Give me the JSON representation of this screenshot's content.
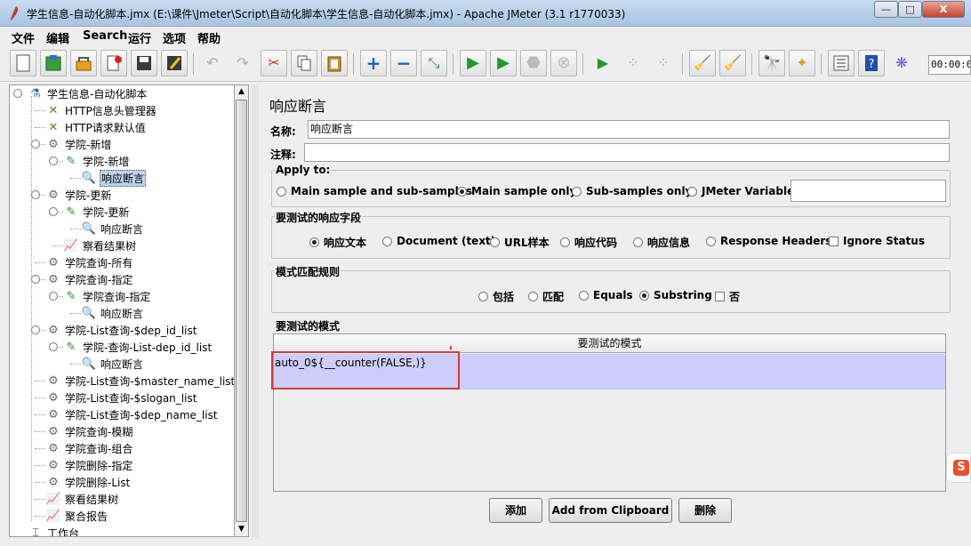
{
  "window": {
    "title": "学生信息-自动化脚本.jmx (E:\\课件\\Jmeter\\Script\\自动化脚本\\学生信息-自动化脚本.jmx) - Apache JMeter (3.1 r1770033)",
    "minimize": "—",
    "maximize": "□",
    "close": "X"
  },
  "menu": [
    "文件",
    "编辑",
    "Search",
    "运行",
    "选项",
    "帮助"
  ],
  "toolbar": {
    "icons": [
      "new-icon",
      "templates-icon",
      "open-icon",
      "close-icon",
      "save-icon",
      "save-as-icon",
      "undo-icon",
      "redo-icon",
      "cut-icon",
      "copy-icon",
      "paste-icon",
      "expand-icon",
      "collapse-icon",
      "toggle-icon",
      "start-icon",
      "start-no-timers-icon",
      "stop-icon",
      "shutdown-icon",
      "remote-start-icon",
      "remote-stop-icon",
      "remote-shutdown-icon",
      "clear-icon",
      "clear-all-icon",
      "search-icon",
      "reset-search-icon",
      "function-helper-icon",
      "help-icon",
      "log-viewer-icon"
    ],
    "timer": "00:00:0"
  },
  "tree": [
    {
      "label": "学生信息-自动化脚本",
      "icon": "test-plan-icon",
      "level": 0
    },
    {
      "label": "HTTP信息头管理器",
      "icon": "config-element-icon",
      "level": 1
    },
    {
      "label": "HTTP请求默认值",
      "icon": "config-element-icon",
      "level": 1
    },
    {
      "label": "学院-新增",
      "icon": "thread-group-icon",
      "level": 1
    },
    {
      "label": "学院-新增",
      "icon": "http-sampler-icon",
      "level": 2
    },
    {
      "label": "响应断言",
      "icon": "assertion-icon",
      "level": 3,
      "selected": true
    },
    {
      "label": "学院-更新",
      "icon": "thread-group-icon",
      "level": 1
    },
    {
      "label": "学院-更新",
      "icon": "http-sampler-icon",
      "level": 2
    },
    {
      "label": "响应断言",
      "icon": "assertion-icon",
      "level": 3
    },
    {
      "label": "察看结果树",
      "icon": "listener-icon",
      "level": 2
    },
    {
      "label": "学院查询-所有",
      "icon": "thread-group-icon",
      "level": 1
    },
    {
      "label": "学院查询-指定",
      "icon": "thread-group-icon",
      "level": 1
    },
    {
      "label": "学院查询-指定",
      "icon": "http-sampler-icon",
      "level": 2
    },
    {
      "label": "响应断言",
      "icon": "assertion-icon",
      "level": 3
    },
    {
      "label": "学院-List查询-$dep_id_list",
      "icon": "thread-group-icon",
      "level": 1
    },
    {
      "label": "学院-查询-List-dep_id_list",
      "icon": "http-sampler-icon",
      "level": 2
    },
    {
      "label": "响应断言",
      "icon": "assertion-icon",
      "level": 3
    },
    {
      "label": "学院-List查询-$master_name_list",
      "icon": "thread-group-icon",
      "level": 1
    },
    {
      "label": "学院-List查询-$slogan_list",
      "icon": "thread-group-icon",
      "level": 1
    },
    {
      "label": "学院-List查询-$dep_name_list",
      "icon": "thread-group-icon",
      "level": 1
    },
    {
      "label": "学院查询-模糊",
      "icon": "thread-group-icon",
      "level": 1
    },
    {
      "label": "学院查询-组合",
      "icon": "thread-group-icon",
      "level": 1
    },
    {
      "label": "学院删除-指定",
      "icon": "thread-group-icon",
      "level": 1
    },
    {
      "label": "学院删除-List",
      "icon": "thread-group-icon",
      "level": 1
    },
    {
      "label": "察看结果树",
      "icon": "listener-icon",
      "level": 1
    },
    {
      "label": "聚合报告",
      "icon": "listener-icon",
      "level": 1
    },
    {
      "label": "工作台",
      "icon": "workbench-icon",
      "level": 0
    }
  ],
  "panel": {
    "title": "响应断言",
    "name_label": "名称:",
    "name_value": "响应断言",
    "comment_label": "注释:",
    "comment_value": "",
    "apply_to": {
      "title": "Apply to:",
      "options": [
        "Main sample and sub-samples",
        "Main sample only",
        "Sub-samples only",
        "JMeter Variable"
      ],
      "selected": "Main sample only",
      "variable_value": ""
    },
    "field_to_test": {
      "title": "要测试的响应字段",
      "options": [
        "响应文本",
        "Document (text)",
        "URL样本",
        "响应代码",
        "响应信息",
        "Response Headers"
      ],
      "selected": "响应文本",
      "checkbox": "Ignore Status",
      "checked": false
    },
    "pattern_rules": {
      "title": "模式匹配规则",
      "options": [
        "包括",
        "匹配",
        "Equals",
        "Substring"
      ],
      "selected": "Substring",
      "checkbox": "否",
      "checked": false
    },
    "patterns": {
      "title": "要测试的模式",
      "column": "要测试的模式",
      "rows": [
        "auto_0${__counter(FALSE,)}"
      ]
    },
    "buttons": [
      "添加",
      "Add from Clipboard",
      "删除"
    ]
  },
  "side_badge": "S"
}
